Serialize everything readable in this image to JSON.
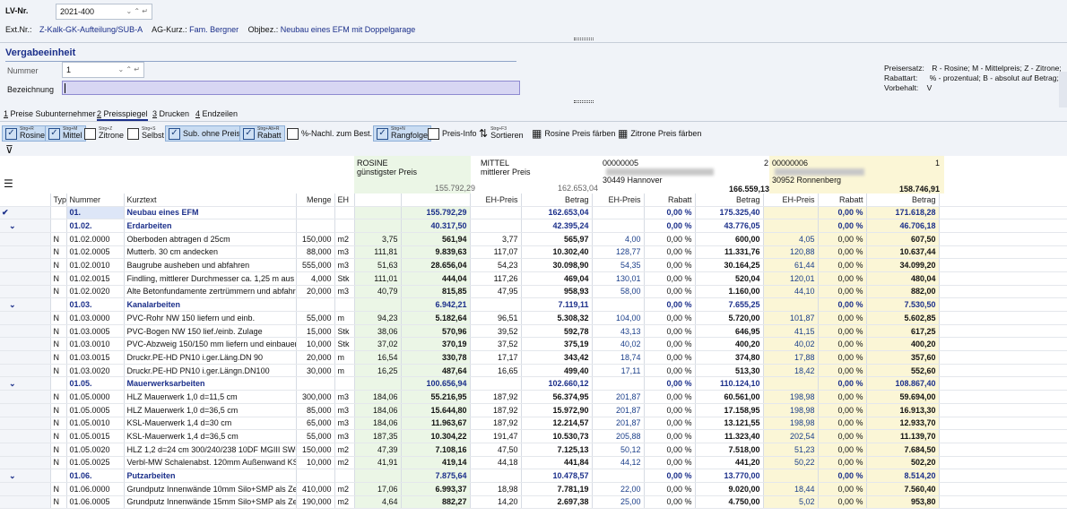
{
  "header": {
    "lv_label": "LV-Nr.",
    "lv_value": "2021-400",
    "ext_label": "Ext.Nr.:",
    "ext_value": "Z-Kalk-GK-Aufteilung/SUB-A",
    "ag_label": "AG-Kurz.:",
    "ag_value": "Fam. Bergner",
    "obj_label": "Objbez.:",
    "obj_value": "Neubau eines EFM mit Doppelgarage"
  },
  "section": {
    "title": "Vergabeeinheit",
    "nummer_label": "Nummer",
    "nummer_value": "1",
    "bez_label": "Bezeichnung",
    "bez_value": "",
    "preisersatz_label": "Preisersatz:",
    "preisersatz_value": "R - Rosine;  M - Mittelpreis;  Z - Zitrone;",
    "rabattart_label": "Rabattart:",
    "rabattart_value": "% - prozentual;  B - absolut auf Betrag;",
    "vorbehalt_label": "Vorbehalt:",
    "vorbehalt_value": "V"
  },
  "tabs": [
    {
      "num": "1",
      "label": "Preise Subunternehmer"
    },
    {
      "num": "2",
      "label": "Preisspiegel"
    },
    {
      "num": "3",
      "label": "Drucken"
    },
    {
      "num": "4",
      "label": "Endzeilen"
    }
  ],
  "toolbar": {
    "rosine": {
      "sc": "Strg+R",
      "label": "Rosine"
    },
    "mittel": {
      "sc": "Strg+M",
      "label": "Mittel"
    },
    "zitrone": {
      "sc": "Strg+Z",
      "label": "Zitrone"
    },
    "selbst": {
      "sc": "Strg+S",
      "label": "Selbst"
    },
    "subohne": "Sub. ohne Preis",
    "rabatt": {
      "sc": "Strg+Alt+R",
      "label": "Rabatt"
    },
    "nachl": "%-Nachl. zum Best.",
    "rangfolge": {
      "sc": "Strg+N",
      "label": "Rangfolge"
    },
    "preisinfo": "Preis-Info",
    "sortieren": {
      "sc": "Strg+F3",
      "label": "Sortieren"
    },
    "rosine_faerben": "Rosine Preis färben",
    "zitrone_faerben": "Zitrone Preis färben"
  },
  "grid_header": {
    "rosine_title": "ROSINE",
    "rosine_sub": "günstigster Preis",
    "rosine_total": "155.792,29",
    "mittel_title": "MITTEL",
    "mittel_sub": "mittlerer Preis",
    "mittel_total": "162.653,04",
    "bid1_no": "00000005",
    "bid1_rank": "2",
    "bid1_city": "30449 Hannover",
    "bid1_total": "166.559,13",
    "bid2_no": "00000006",
    "bid2_rank": "1",
    "bid2_city": "30952 Ronnenberg",
    "bid2_total": "158.746,91",
    "cols": {
      "typ": "Typ",
      "nummer": "Nummer",
      "kurztext": "Kurztext",
      "menge": "Menge",
      "eh": "EH",
      "ehpreis": "EH-Preis",
      "betrag": "Betrag",
      "rabatt": "Rabatt"
    }
  },
  "rows": [
    {
      "g": 1,
      "nr": "01.",
      "text": "Neubau eines EFM",
      "rb": "155.792,29",
      "mb": "162.653,04",
      "r1": "0,00 %",
      "b1": "175.325,40",
      "r2": "0,00 %",
      "b2": "171.618,28"
    },
    {
      "g": 1,
      "nr": "01.02.",
      "text": "Erdarbeiten",
      "rb": "40.317,50",
      "mb": "42.395,24",
      "r1": "0,00 %",
      "b1": "43.776,05",
      "r2": "0,00 %",
      "b2": "46.706,18"
    },
    {
      "typ": "N",
      "nr": "01.02.0000",
      "text": "Oberboden abtragen d 25cm",
      "menge": "150,000",
      "eh": "m2",
      "re": "3,75",
      "rb": "561,94",
      "me": "3,77",
      "mb": "565,97",
      "e1": "4,00",
      "r1": "0,00 %",
      "b1": "600,00",
      "e2": "4,05",
      "r2": "0,00 %",
      "b2": "607,50"
    },
    {
      "typ": "N",
      "nr": "01.02.0005",
      "text": "Mutterb. 30 cm andecken",
      "menge": "88,000",
      "eh": "m3",
      "re": "111,81",
      "rb": "9.839,63",
      "me": "117,07",
      "mb": "10.302,40",
      "e1": "128,77",
      "r1": "0,00 %",
      "b1": "11.331,76",
      "e2": "120,88",
      "r2": "0,00 %",
      "b2": "10.637,44"
    },
    {
      "typ": "N",
      "nr": "01.02.0010",
      "text": "Baugrube ausheben und abfahren",
      "menge": "555,000",
      "eh": "m3",
      "re": "51,63",
      "rb": "28.656,04",
      "me": "54,23",
      "mb": "30.098,90",
      "e1": "54,35",
      "r1": "0,00 %",
      "b1": "30.164,25",
      "e2": "61,44",
      "r2": "0,00 %",
      "b2": "34.099,20"
    },
    {
      "typ": "N",
      "nr": "01.02.0015",
      "text": "Findling, mittlerer Durchmesser ca. 1,25 m  aus der",
      "menge": "4,000",
      "eh": "Stk",
      "re": "111,01",
      "rb": "444,04",
      "me": "117,26",
      "mb": "469,04",
      "e1": "130,01",
      "r1": "0,00 %",
      "b1": "520,04",
      "e2": "120,01",
      "r2": "0,00 %",
      "b2": "480,04"
    },
    {
      "typ": "N",
      "nr": "01.02.0020",
      "text": "Alte Betonfundamente zertrümmern und abfahren",
      "menge": "20,000",
      "eh": "m3",
      "re": "40,79",
      "rb": "815,85",
      "me": "47,95",
      "mb": "958,93",
      "e1": "58,00",
      "r1": "0,00 %",
      "b1": "1.160,00",
      "e2": "44,10",
      "r2": "0,00 %",
      "b2": "882,00"
    },
    {
      "g": 1,
      "nr": "01.03.",
      "text": "Kanalarbeiten",
      "rb": "6.942,21",
      "mb": "7.119,11",
      "r1": "0,00 %",
      "b1": "7.655,25",
      "r2": "0,00 %",
      "b2": "7.530,50"
    },
    {
      "typ": "N",
      "nr": "01.03.0000",
      "text": "PVC-Rohr NW 150 liefern und einb.",
      "menge": "55,000",
      "eh": "m",
      "re": "94,23",
      "rb": "5.182,64",
      "me": "96,51",
      "mb": "5.308,32",
      "e1": "104,00",
      "r1": "0,00 %",
      "b1": "5.720,00",
      "e2": "101,87",
      "r2": "0,00 %",
      "b2": "5.602,85"
    },
    {
      "typ": "N",
      "nr": "01.03.0005",
      "text": "PVC-Bogen NW 150 lief./einb. Zulage",
      "menge": "15,000",
      "eh": "Stk",
      "re": "38,06",
      "rb": "570,96",
      "me": "39,52",
      "mb": "592,78",
      "e1": "43,13",
      "r1": "0,00 %",
      "b1": "646,95",
      "e2": "41,15",
      "r2": "0,00 %",
      "b2": "617,25"
    },
    {
      "typ": "N",
      "nr": "01.03.0010",
      "text": "PVC-Abzweig 150/150 mm liefern und einbauen",
      "menge": "10,000",
      "eh": "Stk",
      "re": "37,02",
      "rb": "370,19",
      "me": "37,52",
      "mb": "375,19",
      "e1": "40,02",
      "r1": "0,00 %",
      "b1": "400,20",
      "e2": "40,02",
      "r2": "0,00 %",
      "b2": "400,20"
    },
    {
      "typ": "N",
      "nr": "01.03.0015",
      "text": "Druckr.PE-HD PN10 i.ger.Läng.DN 90",
      "menge": "20,000",
      "eh": "m",
      "re": "16,54",
      "rb": "330,78",
      "me": "17,17",
      "mb": "343,42",
      "e1": "18,74",
      "r1": "0,00 %",
      "b1": "374,80",
      "e2": "17,88",
      "r2": "0,00 %",
      "b2": "357,60"
    },
    {
      "typ": "N",
      "nr": "01.03.0020",
      "text": "Druckr.PE-HD PN10 i.ger.Längn.DN100",
      "menge": "30,000",
      "eh": "m",
      "re": "16,25",
      "rb": "487,64",
      "me": "16,65",
      "mb": "499,40",
      "e1": "17,11",
      "r1": "0,00 %",
      "b1": "513,30",
      "e2": "18,42",
      "r2": "0,00 %",
      "b2": "552,60"
    },
    {
      "g": 1,
      "nr": "01.05.",
      "text": "Mauerwerksarbeiten",
      "rb": "100.656,94",
      "mb": "102.660,12",
      "r1": "0,00 %",
      "b1": "110.124,10",
      "r2": "0,00 %",
      "b2": "108.867,40"
    },
    {
      "typ": "N",
      "nr": "01.05.0000",
      "text": "HLZ Mauerwerk 1,0 d=11,5 cm",
      "menge": "300,000",
      "eh": "m3",
      "re": "184,06",
      "rb": "55.216,95",
      "me": "187,92",
      "mb": "56.374,95",
      "e1": "201,87",
      "r1": "0,00 %",
      "b1": "60.561,00",
      "e2": "198,98",
      "r2": "0,00 %",
      "b2": "59.694,00"
    },
    {
      "typ": "N",
      "nr": "01.05.0005",
      "text": "HLZ Mauerwerk 1,0 d=36,5 cm",
      "menge": "85,000",
      "eh": "m3",
      "re": "184,06",
      "rb": "15.644,80",
      "me": "187,92",
      "mb": "15.972,90",
      "e1": "201,87",
      "r1": "0,00 %",
      "b1": "17.158,95",
      "e2": "198,98",
      "r2": "0,00 %",
      "b2": "16.913,30"
    },
    {
      "typ": "N",
      "nr": "01.05.0010",
      "text": "KSL-Mauerwerk 1,4 d=30 cm",
      "menge": "65,000",
      "eh": "m3",
      "re": "184,06",
      "rb": "11.963,67",
      "me": "187,92",
      "mb": "12.214,57",
      "e1": "201,87",
      "r1": "0,00 %",
      "b1": "13.121,55",
      "e2": "198,98",
      "r2": "0,00 %",
      "b2": "12.933,70"
    },
    {
      "typ": "N",
      "nr": "01.05.0015",
      "text": "KSL-Mauerwerk 1,4 d=36,5 cm",
      "menge": "55,000",
      "eh": "m3",
      "re": "187,35",
      "rb": "10.304,22",
      "me": "191,47",
      "mb": "10.530,73",
      "e1": "205,88",
      "r1": "0,00 %",
      "b1": "11.323,40",
      "e2": "202,54",
      "r2": "0,00 %",
      "b2": "11.139,70"
    },
    {
      "typ": "N",
      "nr": "01.05.0020",
      "text": "HLZ 1,2 d=24 cm 300/240/238 10DF MGIII SWG1",
      "menge": "150,000",
      "eh": "m2",
      "re": "47,39",
      "rb": "7.108,16",
      "me": "47,50",
      "mb": "7.125,13",
      "e1": "50,12",
      "r1": "0,00 %",
      "b1": "7.518,00",
      "e2": "51,23",
      "r2": "0,00 %",
      "b2": "7.684,50"
    },
    {
      "typ": "N",
      "nr": "01.05.0025",
      "text": "Verbl-MW Schalenabst. 120mm Außenwand KS Vb",
      "menge": "10,000",
      "eh": "m2",
      "re": "41,91",
      "rb": "419,14",
      "me": "44,18",
      "mb": "441,84",
      "e1": "44,12",
      "r1": "0,00 %",
      "b1": "441,20",
      "e2": "50,22",
      "r2": "0,00 %",
      "b2": "502,20"
    },
    {
      "g": 1,
      "nr": "01.06.",
      "text": "Putzarbeiten",
      "rb": "7.875,64",
      "mb": "10.478,57",
      "r1": "0,00 %",
      "b1": "13.770,00",
      "r2": "0,00 %",
      "b2": "8.514,20"
    },
    {
      "typ": "N",
      "nr": "01.06.0000",
      "text": "Grundputz Innenwände 10mm Silo+SMP als Zement",
      "menge": "410,000",
      "eh": "m2",
      "re": "17,06",
      "rb": "6.993,37",
      "me": "18,98",
      "mb": "7.781,19",
      "e1": "22,00",
      "r1": "0,00 %",
      "b1": "9.020,00",
      "e2": "18,44",
      "r2": "0,00 %",
      "b2": "7.560,40"
    },
    {
      "typ": "N",
      "nr": "01.06.0005",
      "text": "Grundputz Innenwände 15mm Silo+SMP als Zement",
      "menge": "190,000",
      "eh": "m2",
      "re": "4,64",
      "rb": "882,27",
      "me": "14,20",
      "mb": "2.697,38",
      "e1": "25,00",
      "r1": "0,00 %",
      "b1": "4.750,00",
      "e2": "5,02",
      "r2": "0,00 %",
      "b2": "953,80"
    }
  ]
}
